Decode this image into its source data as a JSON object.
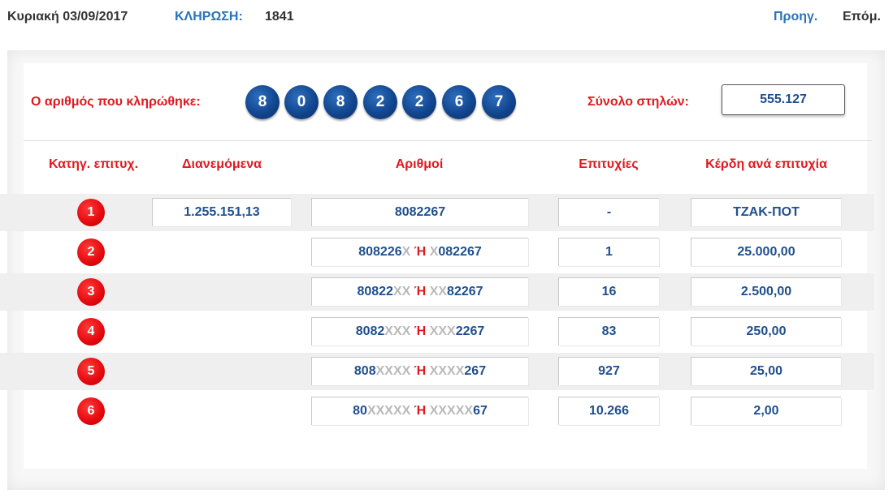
{
  "header": {
    "date": "Κυριακή 03/09/2017",
    "draw_label": "ΚΛΗΡΩΣΗ:",
    "draw_number": "1841",
    "prev_label": "Προηγ.",
    "next_label": "Επόμ."
  },
  "drawn": {
    "label": "Ο αριθμός που κληρώθηκε:",
    "digits": [
      "8",
      "0",
      "8",
      "2",
      "2",
      "6",
      "7"
    ]
  },
  "total": {
    "label": "Σύνολο στηλών:",
    "value": "555.127"
  },
  "table": {
    "headers": {
      "category": "Κατηγ. επιτυχ.",
      "distributed": "Διανεμόμενα",
      "numbers": "Αριθμοί",
      "winners": "Επιτυχίες",
      "prize": "Κέρδη ανά επιτυχία"
    },
    "or_word": "Ή",
    "rows": [
      {
        "category": "1",
        "distributed": "1.255.151,13",
        "numbers_full": "8082267",
        "left_prefix": "",
        "left_mask": "",
        "right_mask": "",
        "right_suffix": "",
        "winners": "-",
        "prize": "ΤΖΑΚ-ΠΟΤ"
      },
      {
        "category": "2",
        "distributed": "",
        "numbers_full": "",
        "left_prefix": "808226",
        "left_mask": "X",
        "right_mask": "X",
        "right_suffix": "082267",
        "winners": "1",
        "prize": "25.000,00"
      },
      {
        "category": "3",
        "distributed": "",
        "numbers_full": "",
        "left_prefix": "80822",
        "left_mask": "XX",
        "right_mask": "XX",
        "right_suffix": "82267",
        "winners": "16",
        "prize": "2.500,00"
      },
      {
        "category": "4",
        "distributed": "",
        "numbers_full": "",
        "left_prefix": "8082",
        "left_mask": "XXX",
        "right_mask": "XXX",
        "right_suffix": "2267",
        "winners": "83",
        "prize": "250,00"
      },
      {
        "category": "5",
        "distributed": "",
        "numbers_full": "",
        "left_prefix": "808",
        "left_mask": "XXXX",
        "right_mask": "XXXX",
        "right_suffix": "267",
        "winners": "927",
        "prize": "25,00"
      },
      {
        "category": "6",
        "distributed": "",
        "numbers_full": "",
        "left_prefix": "80",
        "left_mask": "XXXXX",
        "right_mask": "XXXXX",
        "right_suffix": "67",
        "winners": "10.266",
        "prize": "2,00"
      }
    ]
  },
  "colors": {
    "accent_blue": "#2a73b9",
    "value_blue": "#1f4f8f",
    "label_red": "#e0191f",
    "ball_blue": "#12468f",
    "mask_grey": "#b9b9b9"
  }
}
